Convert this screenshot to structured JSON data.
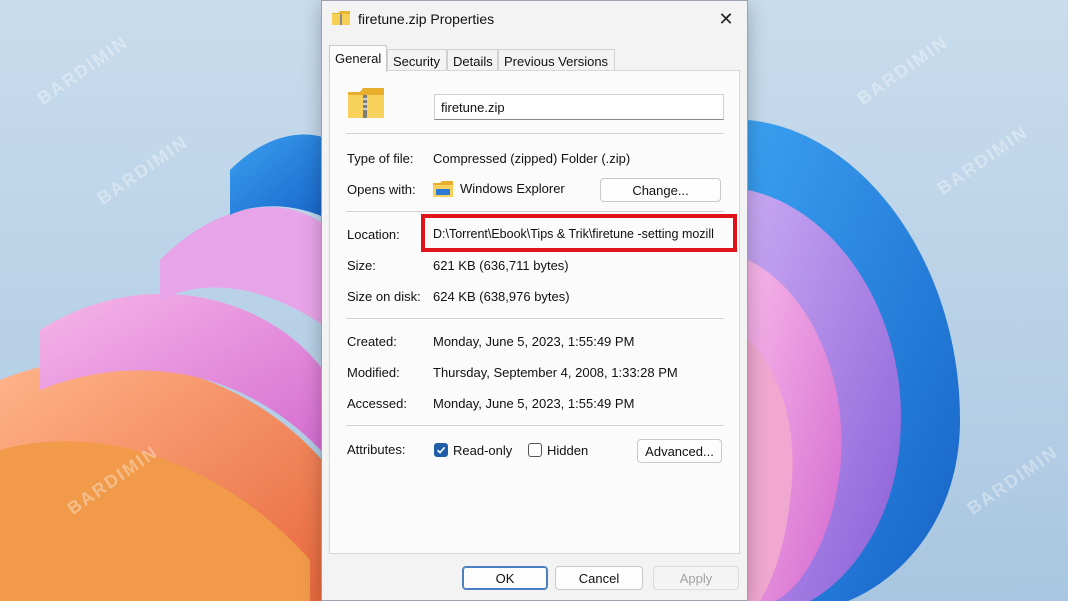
{
  "window": {
    "title": "firetune.zip Properties",
    "close_glyph": "✕"
  },
  "tabs": [
    {
      "label": "General",
      "active": true
    },
    {
      "label": "Security",
      "active": false
    },
    {
      "label": "Details",
      "active": false
    },
    {
      "label": "Previous Versions",
      "active": false
    }
  ],
  "general": {
    "file_name": "firetune.zip",
    "type_label": "Type of file:",
    "type_value": "Compressed (zipped) Folder (.zip)",
    "opens_label": "Opens with:",
    "opens_value": "Windows Explorer",
    "change_button": "Change...",
    "location_label": "Location:",
    "location_value": "D:\\Torrent\\Ebook\\Tips & Trik\\firetune -setting mozill",
    "size_label": "Size:",
    "size_value": "621 KB (636,711 bytes)",
    "size_on_disk_label": "Size on disk:",
    "size_on_disk_value": "624 KB (638,976 bytes)",
    "created_label": "Created:",
    "created_value": "Monday, June 5, 2023, 1:55:49 PM",
    "modified_label": "Modified:",
    "modified_value": "Thursday, September 4, 2008, 1:33:28 PM",
    "accessed_label": "Accessed:",
    "accessed_value": "Monday, June 5, 2023, 1:55:49 PM",
    "attributes_label": "Attributes:",
    "readonly_label": "Read-only",
    "readonly_checked": true,
    "hidden_label": "Hidden",
    "hidden_checked": false,
    "advanced_button": "Advanced..."
  },
  "footer": {
    "ok": "OK",
    "cancel": "Cancel",
    "apply": "Apply"
  },
  "watermark": "BARDIMIN",
  "colors": {
    "highlight": "#e0131b",
    "checkbox": "#1f5fa8",
    "folder": "#f4c542"
  }
}
